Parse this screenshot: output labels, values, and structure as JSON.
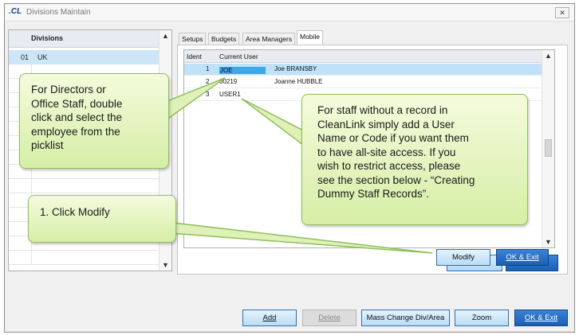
{
  "window": {
    "title": "Divisions Maintain",
    "app_icon": ".CL",
    "close_label": "✕"
  },
  "divisions": {
    "header": "Divisions",
    "rows": [
      {
        "code": "01",
        "name": "UK"
      }
    ]
  },
  "tabs": [
    "Setups",
    "Budgets",
    "Area Managers",
    "Mobile"
  ],
  "active_tab": "Mobile",
  "mobile_grid": {
    "columns": [
      "Ident",
      "Current User"
    ],
    "rows": [
      {
        "ident": "1",
        "user": "JOE",
        "name": "Joe BRANSBY",
        "selected": true
      },
      {
        "ident": "2",
        "user": "00219",
        "name": "Joanne HUBBLE",
        "selected": false
      },
      {
        "ident": "3",
        "user": "USER1",
        "name": "",
        "selected": false
      }
    ]
  },
  "inner_buttons": {
    "modify": "Modify",
    "ok_exit": "OK & Exit"
  },
  "footer_buttons": {
    "add": "Add",
    "delete": "Delete",
    "mass_change": "Mass Change Div/Area",
    "zoom": "Zoom",
    "ok_exit": "OK & Exit"
  },
  "callouts": {
    "directors": [
      "For Directors or",
      "Office Staff, double",
      "click and select the",
      "employee from the",
      "picklist"
    ],
    "staff": [
      "For staff without a record in",
      "CleanLink simply add a User",
      "Name or Code if you want them",
      "to have all-site access.  If you",
      "wish to restrict access, please",
      "see the section below - “Creating",
      "Dummy Staff Records”."
    ],
    "modify": [
      "1. Click Modify"
    ]
  },
  "colors": {
    "callout_fill": "#e6f5c4",
    "callout_border": "#8fbf5a",
    "selection": "#bfe2f8",
    "button_primary": "#1a5fb4"
  }
}
